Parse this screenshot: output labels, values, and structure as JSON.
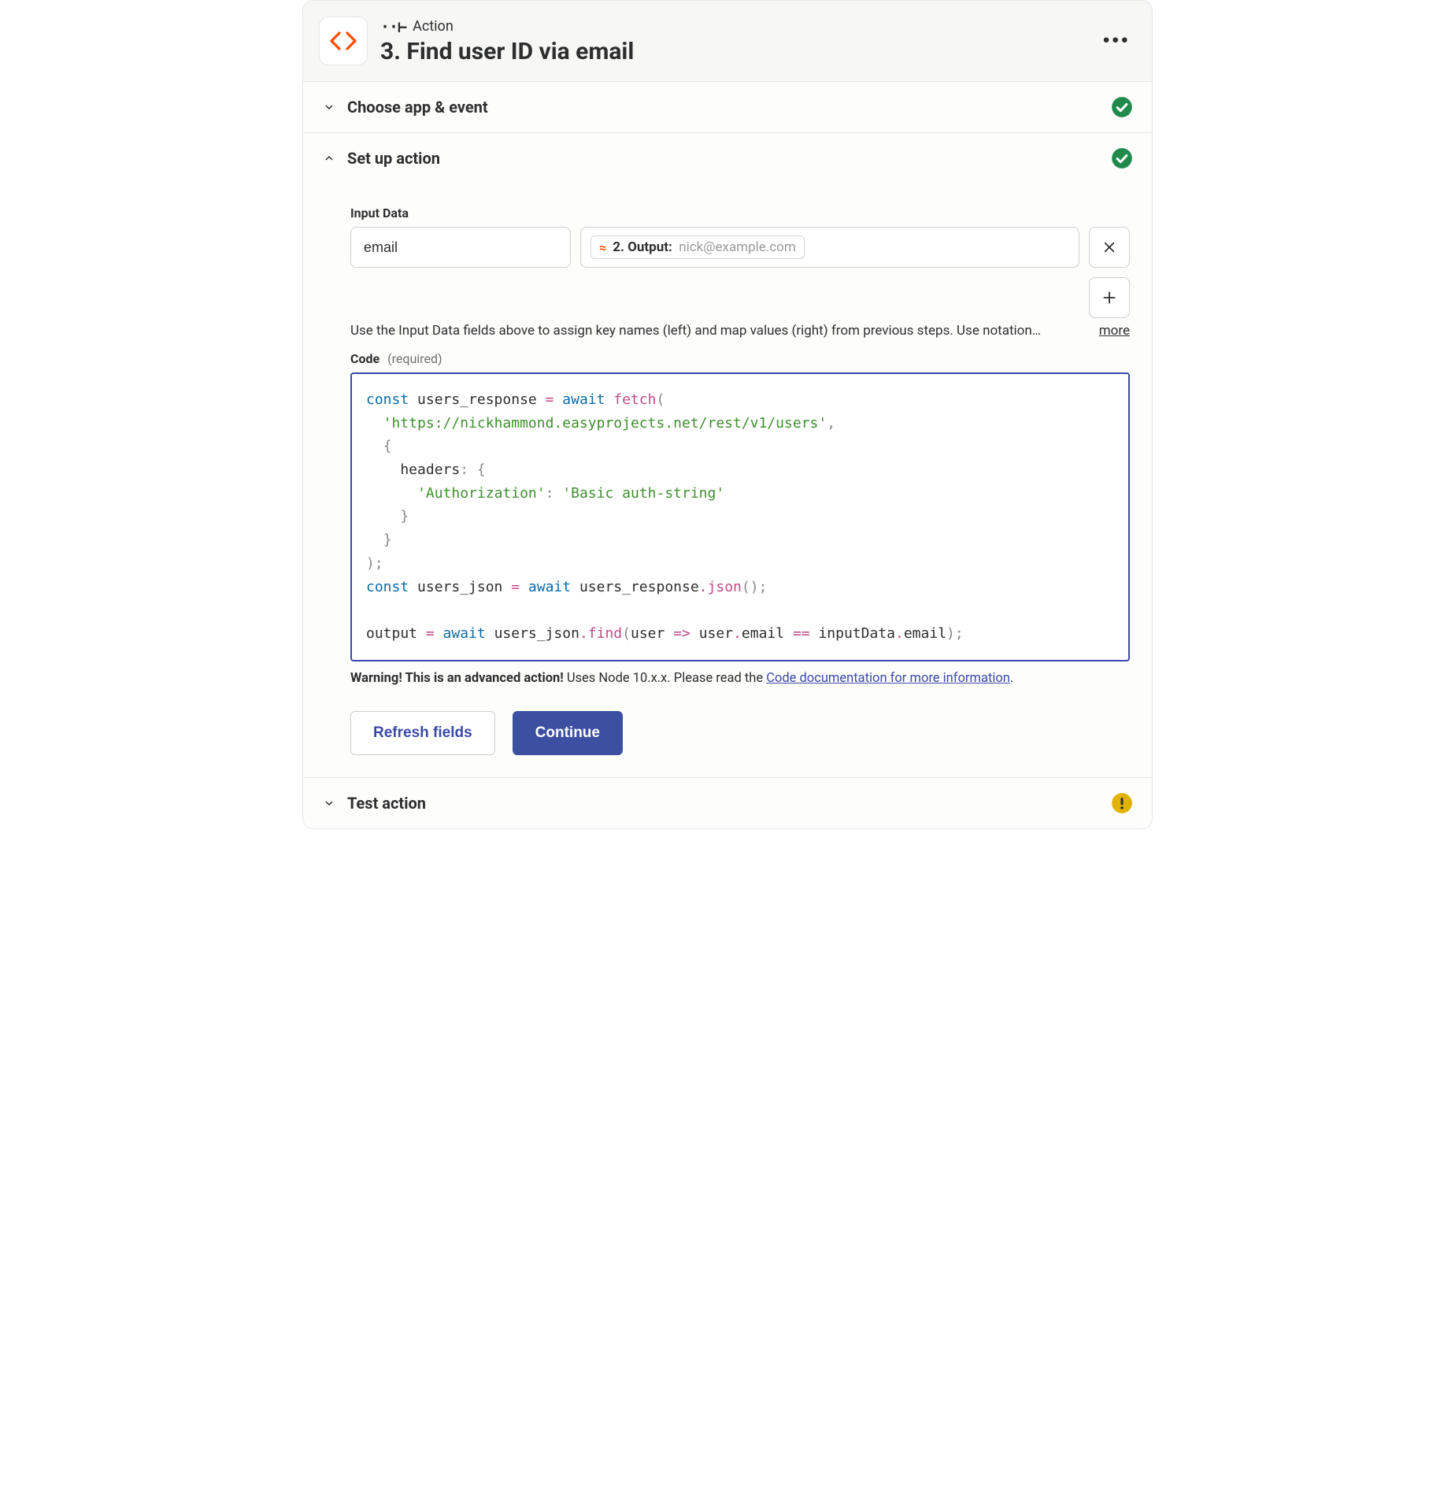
{
  "header": {
    "kicker": "Action",
    "title": "3. Find user ID via email"
  },
  "sections": {
    "choose": {
      "title": "Choose app & event"
    },
    "setup": {
      "title": "Set up action",
      "input_data_label": "Input Data",
      "key_value": "email",
      "pill_prefix": "2. Output:",
      "pill_value": "nick@example.com",
      "help_text": "Use the Input Data fields above to assign key names (left) and map values (right) from previous steps. Use notation…",
      "more_label": "more",
      "code_label": "Code",
      "code_required": "(required)",
      "warning_bold": "Warning! This is an advanced action!",
      "warning_rest": " Uses Node 10.x.x. Please read the ",
      "warning_link": "Code documentation for more information",
      "warning_period": ".",
      "refresh_btn": "Refresh fields",
      "continue_btn": "Continue"
    },
    "test": {
      "title": "Test action"
    }
  },
  "code": {
    "url": "'https://nickhammond.easyprojects.net/rest/v1/users'",
    "auth_key": "'Authorization'",
    "auth_val": "'Basic auth-string'"
  }
}
